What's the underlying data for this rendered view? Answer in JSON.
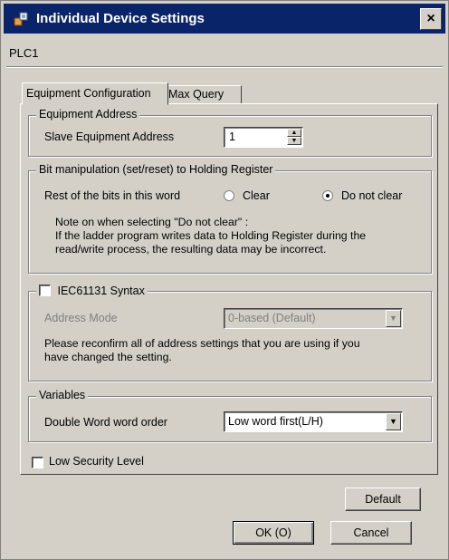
{
  "window": {
    "title": "Individual Device Settings",
    "close_label": "×",
    "device_name": "PLC1"
  },
  "tabs": [
    {
      "label": "Equipment Configuration",
      "active": true
    },
    {
      "label": "Max Query",
      "active": false
    }
  ],
  "equipment_address": {
    "legend": "Equipment Address",
    "slave_label": "Slave Equipment Address",
    "slave_value": "1"
  },
  "bit_manipulation": {
    "legend": "Bit manipulation (set/reset) to Holding Register",
    "rest_label": "Rest of the bits in this word",
    "option_clear": "Clear",
    "option_do_not_clear": "Do not clear",
    "selected": "Do not clear",
    "note_line1": "Note on when selecting \"Do not clear\" :",
    "note_line2": "If the ladder program writes data to Holding Register during the",
    "note_line3": "read/write process, the resulting data may be incorrect."
  },
  "iec": {
    "checkbox_label": "IEC61131 Syntax",
    "checked": false,
    "address_mode_label": "Address Mode",
    "address_mode_value": "0-based (Default)",
    "reconfirm_line1": "Please reconfirm all of address settings that you are using if you",
    "reconfirm_line2": "have changed the setting."
  },
  "variables": {
    "legend": "Variables",
    "word_order_label": "Double Word word order",
    "word_order_value": "Low word first(L/H)"
  },
  "low_security": {
    "label": "Low Security Level",
    "checked": false
  },
  "buttons": {
    "default": "Default",
    "ok": "OK (O)",
    "cancel": "Cancel"
  },
  "colors": {
    "titlebar": "#0a246a",
    "face": "#d4d0c8"
  }
}
